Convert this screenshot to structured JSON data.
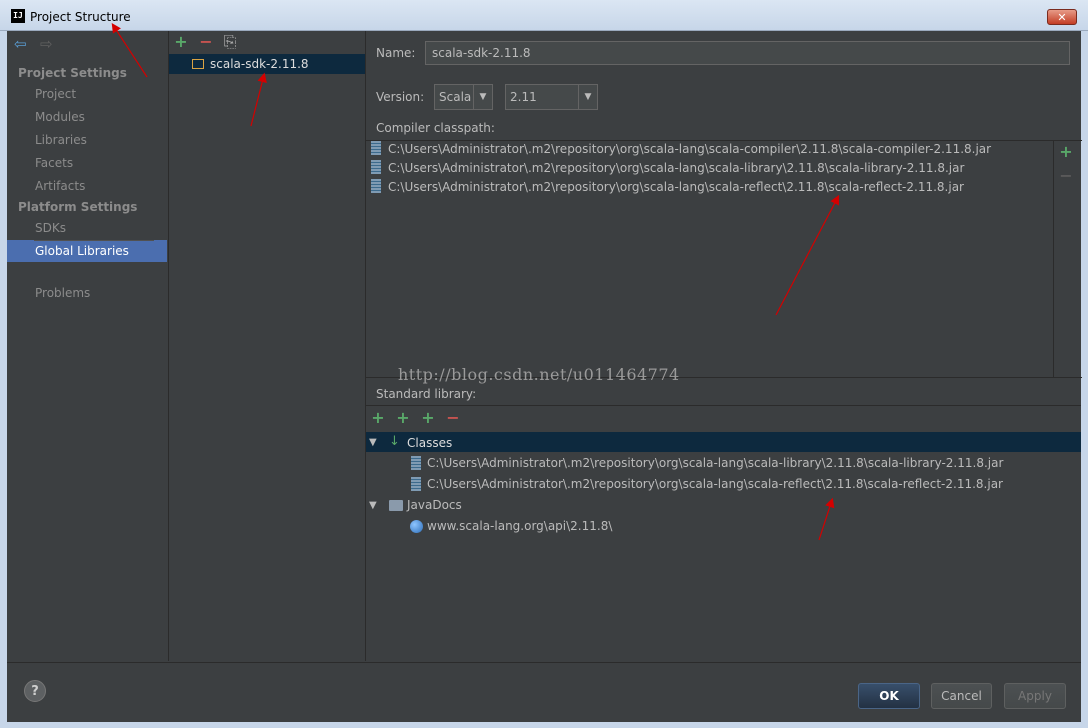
{
  "window": {
    "title": "Project Structure",
    "icon_label": "IJ",
    "close_icon": "close-icon",
    "close_glyph": "✕"
  },
  "nav": {
    "back_glyph": "⇦",
    "forward_glyph": "⇨",
    "sections": [
      {
        "label": "Project Settings",
        "items": [
          "Project",
          "Modules",
          "Libraries",
          "Facets",
          "Artifacts"
        ]
      },
      {
        "label": "Platform Settings",
        "items": [
          "SDKs",
          "Global Libraries"
        ]
      }
    ],
    "selected": "Global Libraries",
    "extra_item": "Problems"
  },
  "list": {
    "toolbar": {
      "add_glyph": "+",
      "remove_glyph": "−",
      "copy_glyph": "⎘"
    },
    "items": [
      "scala-sdk-2.11.8"
    ]
  },
  "detail": {
    "name_label": "Name:",
    "name_value": "scala-sdk-2.11.8",
    "version_label": "Version:",
    "version_lang": "Scala",
    "version_number": "2.11",
    "combo_arrow": "▼",
    "compiler_classpath_label": "Compiler classpath:",
    "compiler_classpath": [
      "C:\\Users\\Administrator\\.m2\\repository\\org\\scala-lang\\scala-compiler\\2.11.8\\scala-compiler-2.11.8.jar",
      "C:\\Users\\Administrator\\.m2\\repository\\org\\scala-lang\\scala-library\\2.11.8\\scala-library-2.11.8.jar",
      "C:\\Users\\Administrator\\.m2\\repository\\org\\scala-lang\\scala-reflect\\2.11.8\\scala-reflect-2.11.8.jar"
    ],
    "side_add_glyph": "+",
    "side_remove_glyph": "−",
    "watermark": "http://blog.csdn.net/u011464774",
    "standard_library_label": "Standard library:",
    "std_toolbar": {
      "add": "+",
      "add_web": "+",
      "add_jar": "+",
      "remove": "−"
    },
    "tree": {
      "expand_glyph": "▼",
      "classes_label": "Classes",
      "classes_glyph": "↓",
      "classes": [
        "C:\\Users\\Administrator\\.m2\\repository\\org\\scala-lang\\scala-library\\2.11.8\\scala-library-2.11.8.jar",
        "C:\\Users\\Administrator\\.m2\\repository\\org\\scala-lang\\scala-reflect\\2.11.8\\scala-reflect-2.11.8.jar"
      ],
      "javadocs_label": "JavaDocs",
      "javadocs": [
        "www.scala-lang.org\\api\\2.11.8\\"
      ]
    }
  },
  "buttons": {
    "help": "?",
    "ok": "OK",
    "cancel": "Cancel",
    "apply": "Apply"
  },
  "colors": {
    "selection": "#4b6eaf",
    "row_selection": "#0d293e",
    "annotation": "#d40000"
  }
}
